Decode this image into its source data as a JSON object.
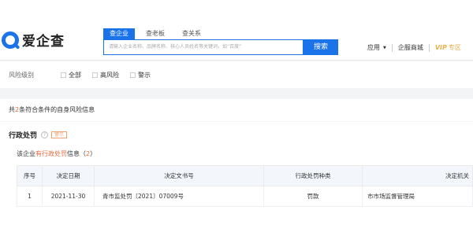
{
  "header": {
    "logo_text": "爱企查",
    "tabs": [
      {
        "label": "查企业"
      },
      {
        "label": "查老板"
      },
      {
        "label": "查关系"
      }
    ],
    "search_placeholder": "请输入企业名称、品牌名称、核心人员姓名等关键词，如“百度”",
    "search_button": "搜索",
    "nav": {
      "app": "应用",
      "mall": "企服商城",
      "vip": "VIP",
      "vip_zone": "专区"
    }
  },
  "filter": {
    "label": "风险级别",
    "options": [
      {
        "label": "全部"
      },
      {
        "label": "高风险"
      },
      {
        "label": "警示"
      }
    ]
  },
  "summary": {
    "prefix": "共",
    "count": "2",
    "suffix": "条符合条件的自身风险信息"
  },
  "section": {
    "title": "行政处罚",
    "help": "?",
    "badge": "警示",
    "sub_prefix": "该企业",
    "sub_highlight": "有行政处罚",
    "sub_middle": "信息（",
    "sub_count": "2",
    "sub_end": "）"
  },
  "table": {
    "headers": [
      "序号",
      "决定日期",
      "决定文书号",
      "行政处罚种类",
      "决定机关"
    ],
    "rows": [
      [
        "1",
        "2021-11-30",
        "青市监处罚〔2021〕07009号",
        "罚款",
        "市市场监督管理局"
      ]
    ]
  },
  "colors": {
    "accent": "#1a73e8",
    "highlight": "#e8693a",
    "vip": "#e8b049"
  }
}
